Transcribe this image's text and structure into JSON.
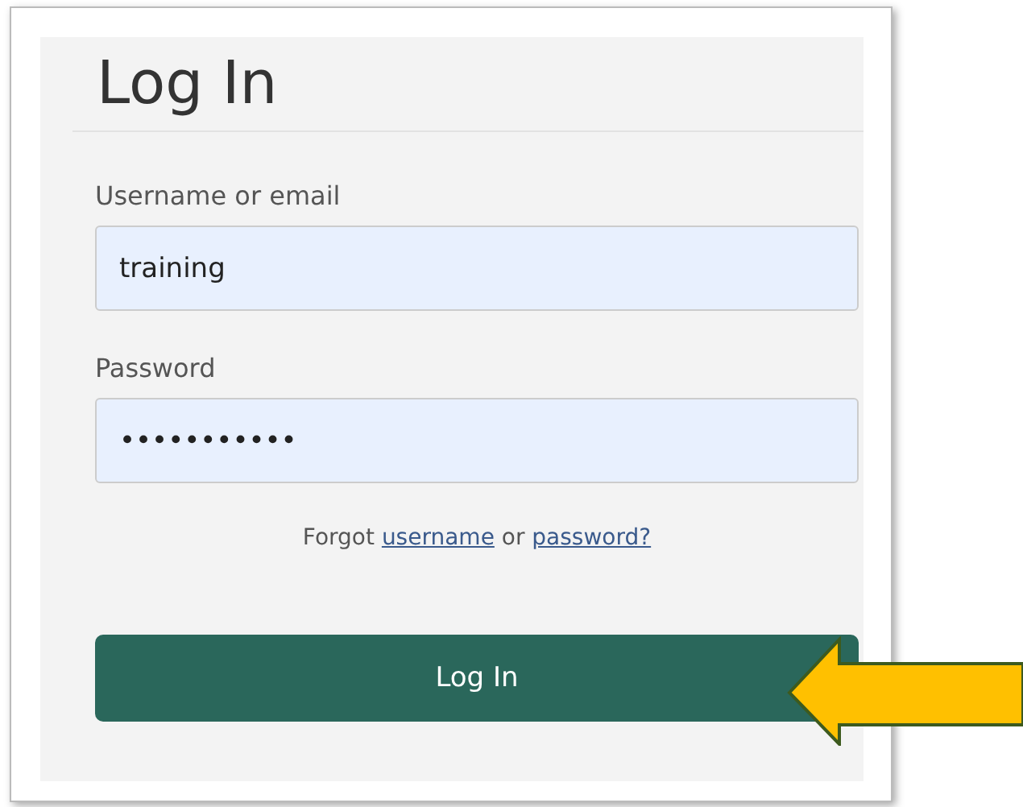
{
  "title": "Log In",
  "fields": [
    {
      "label": "Username or email",
      "value": "training"
    },
    {
      "label": "Password",
      "value": "•••••••••••"
    }
  ],
  "forgot": {
    "prefix": "Forgot",
    "first_link": "username",
    "joiner": "or",
    "second_link": "password?"
  },
  "button": "Log In"
}
